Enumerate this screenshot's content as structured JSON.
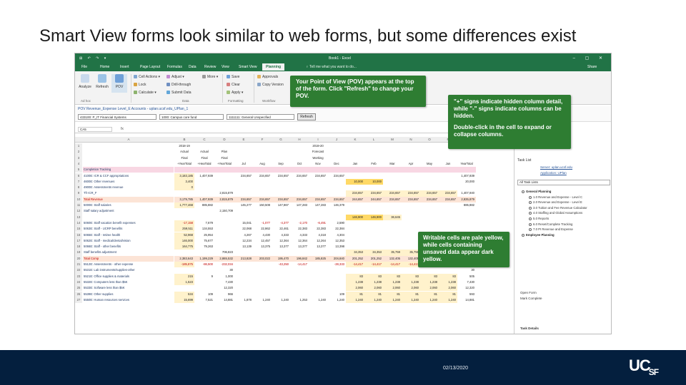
{
  "slide": {
    "title": "Smart View forms look similar to web forms, but some differences exist",
    "date": "02/13/2020",
    "logo_main": "UC",
    "logo_sub": "SF"
  },
  "colors": {
    "excel_green": "#217346",
    "callout_green": "#2e7d32",
    "footer_navy": "#041f3e",
    "writable_yellow": "#fff2cc",
    "unsaved_yellow": "#ffd966",
    "header_pink": "#f8d7e3"
  },
  "excel": {
    "quick_access": "⊞ ↶ ↷ ▾",
    "document_title": "Book1 - Excel",
    "window_controls": "– ▢ ✕",
    "tabs": [
      "File",
      "Home",
      "Insert",
      "Page Layout",
      "Formulas",
      "Data",
      "Review",
      "View",
      "Smart View",
      "Planning"
    ],
    "active_tab": "Planning",
    "tell_me": "♀ Tell me what you want to do...",
    "share": "Share",
    "ribbon": {
      "analyze": "Analyze",
      "refresh": "Refresh",
      "pov": "POV",
      "cell_actions": "Cell Actions ▾",
      "lock": "Lock",
      "calculate": "Calculate ▾",
      "adjust": "Adjust ▾",
      "drill_through": "Drill-through",
      "submit_data": "Submit Data",
      "more": "More ▾",
      "save": "Save",
      "clear": "Clear",
      "apply": "Apply ▾",
      "approvals": "Approvals",
      "copy_version": "Copy Version",
      "group_adhoc": "Ad hoc",
      "group_data": "Data",
      "group_formatting": "Formatting",
      "group_workflow": "Workflow"
    },
    "pov_bar": {
      "label": "POV Revenue_Expense Level_E Accounts - uplan.ucsf.edu_UPlan_1",
      "fields": [
        "433100: P_IT Financial Systems",
        "1000: Campus core fund",
        "1111111: General Unspecified"
      ],
      "refresh": "Refresh"
    },
    "name_box": "CA5",
    "fx": "fx"
  },
  "grid": {
    "col_headers": [
      "A",
      "B",
      "C",
      "D",
      "E",
      "F",
      "G",
      "H",
      "I",
      "J",
      "K",
      "L",
      "M",
      "N",
      "O",
      "P",
      "Q",
      "R"
    ],
    "header_rows": [
      {
        "n": "1",
        "cells": {
          "c1": "2018-19",
          "c8": "2019-20"
        }
      },
      {
        "n": "2",
        "cells": {
          "c1": "Actual",
          "c2": "Actual",
          "c3": "Plan",
          "c8": "Forecast"
        }
      },
      {
        "n": "3",
        "cells": {
          "c1": "Final",
          "c2": "Final",
          "c3": "Final",
          "c8": "Working"
        }
      },
      {
        "n": "4",
        "cells": {
          "c1": "+YearTotal",
          "c2": "+HeaTotal",
          "c3": "+YearTotal",
          "c4": "Jul",
          "c5": "Aug",
          "c6": "Sep",
          "c7": "Oct",
          "c8": "Nov",
          "c9": "Dec",
          "c10": "Jan",
          "c11": "Feb",
          "c12": "Mar",
          "c13": "Apr",
          "c14": "May",
          "c15": "Jun",
          "c16": "YearTotal"
        }
      }
    ],
    "data_rows": [
      {
        "n": "5",
        "label": "Completion Tracking",
        "vals": []
      },
      {
        "n": "6",
        "label": "4100E: ICR & CCF appropriations",
        "vals": [
          "3,183,185",
          "1,407,939",
          "",
          "234,657",
          "234,657",
          "234,657",
          "234,657",
          "234,657",
          "234,657",
          "",
          "",
          "",
          "",
          "",
          "",
          "1,407,939"
        ]
      },
      {
        "n": "7",
        "label": "4600E: Other revenues",
        "vals": [
          "3,400",
          "",
          "",
          "",
          "",
          "",
          "",
          "",
          "",
          "10,000",
          "10,000",
          "",
          "",
          "",
          "",
          "20,000"
        ]
      },
      {
        "n": "8",
        "label": "4900E: Assessments revenue",
        "vals": [
          "0",
          "",
          "",
          "",
          "",
          "",
          "",
          "",
          "",
          "",
          "",
          "",
          "",
          "",
          "",
          ""
        ]
      },
      {
        "n": "9",
        "label": "Tfr ICR_F",
        "vals": [
          "",
          "",
          "2,815,879",
          "",
          "",
          "",
          "",
          "",
          "",
          "234,657",
          "234,657",
          "234,657",
          "234,657",
          "234,657",
          "234,657",
          "1,407,940"
        ]
      },
      {
        "n": "10",
        "label": "Total Revenue",
        "vals": [
          "3,179,785",
          "1,407,939",
          "2,815,879",
          "234,657",
          "234,657",
          "234,657",
          "234,657",
          "234,657",
          "234,657",
          "244,657",
          "244,657",
          "234,657",
          "234,657",
          "234,657",
          "234,657",
          "2,835,879"
        ]
      },
      {
        "n": "11",
        "label": "5000E: Staff salaries",
        "vals": [
          "1,777,468",
          "885,882",
          "",
          "145,277",
          "150,508",
          "147,867",
          "147,283",
          "147,283",
          "146,379",
          "",
          "",
          "",
          "",
          "",
          "",
          "885,882"
        ]
      },
      {
        "n": "12",
        "label": "Staff salary adjustment",
        "vals": [
          "",
          "",
          "2,150,709",
          "",
          "",
          "",
          "",
          "",
          "",
          "",
          "",
          "",
          "",
          "",
          "",
          ""
        ]
      },
      {
        "n": "13",
        "label": "",
        "vals": [
          "",
          "",
          "",
          "",
          "",
          "",
          "",
          "",
          "",
          "146,900",
          "146,900",
          "36,645",
          "",
          "",
          "",
          ""
        ]
      },
      {
        "n": "14",
        "label": "5060E: Staff vacation benefit expenses",
        "vals": [
          "-17,158",
          "7,679",
          "",
          "15,041",
          "-1,077",
          "-4,377",
          "-2,170",
          "-6,491",
          "2,590",
          "",
          "",
          "",
          "",
          "",
          "",
          ""
        ]
      },
      {
        "n": "15",
        "label": "5063E: Staff - UCRP benefits",
        "vals": [
          "259,511",
          "134,553",
          "",
          "22,068",
          "22,862",
          "22,461",
          "22,383",
          "22,383",
          "22,384",
          "",
          "",
          "",
          "",
          "",
          "",
          ""
        ]
      },
      {
        "n": "16",
        "label": "5065E: Staff - retiree health",
        "vals": [
          "52,968",
          "25,954",
          "",
          "4,267",
          "4,430",
          "4,333",
          "4,333",
          "4,318",
          "4,304",
          "",
          "",
          "",
          "",
          "",
          "",
          ""
        ]
      },
      {
        "n": "17",
        "label": "5062E: Staff - medical/dental/vision",
        "vals": [
          "146,000",
          "75,677",
          "",
          "12,234",
          "12,457",
          "12,364",
          "12,364",
          "12,264",
          "12,353",
          "",
          "",
          "",
          "",
          "",
          "",
          ""
        ]
      },
      {
        "n": "18",
        "label": "5066E: Staff - other benefits",
        "vals": [
          "164,775",
          "79,263",
          "",
          "13,139",
          "13,375",
          "13,377",
          "13,377",
          "13,377",
          "13,398",
          "",
          "",
          "",
          "",
          "",
          "",
          ""
        ]
      },
      {
        "n": "19",
        "label": "Staff benefits adjustment",
        "vals": [
          "",
          "",
          "706,823",
          "",
          "",
          "",
          "",
          "",
          "",
          "34,353",
          "34,353",
          "35,759",
          "35,759",
          "35,759",
          "35,759",
          "251,741"
        ]
      },
      {
        "n": "20",
        "label": "Total Comp",
        "vals": [
          "2,383,643",
          "1,199,229",
          "2,865,532",
          "213,828",
          "203,022",
          "195,470",
          "196,842",
          "185,825",
          "204,840",
          "201,252",
          "201,252",
          "132,405",
          "132,405",
          "132,405",
          "132,405",
          "2,313,792"
        ]
      },
      {
        "n": "21",
        "label": "5512E: Assessments - other expense",
        "vals": [
          "-185,875",
          "-86,500",
          "-232,034",
          "",
          "",
          "-43,250",
          "-14,417",
          "",
          "-28,333",
          "-14,417",
          "-14,417",
          "-14,417",
          "-14,417",
          "-14,417",
          "-14,417",
          "-173,000"
        ]
      },
      {
        "n": "22",
        "label": "5531E: Lab instruments/supplies-other",
        "vals": [
          "",
          "",
          "30",
          "",
          "",
          "",
          "",
          "",
          "",
          "",
          "",
          "",
          "",
          "",
          "",
          "30"
        ]
      },
      {
        "n": "23",
        "label": "5521E: Office supplies & materials",
        "vals": [
          "215",
          "9",
          "1,000",
          "",
          "",
          "",
          "",
          "",
          "",
          "83",
          "83",
          "83",
          "83",
          "83",
          "83",
          "505"
        ]
      },
      {
        "n": "24",
        "label": "5532E: Computers less than $5K",
        "vals": [
          "1,523",
          "",
          "7,430",
          "",
          "",
          "",
          "",
          "",
          "",
          "1,238",
          "1,238",
          "1,238",
          "1,238",
          "1,238",
          "1,238",
          "7,430"
        ]
      },
      {
        "n": "25",
        "label": "5533E: Software less than $5K",
        "vals": [
          "",
          "",
          "12,320",
          "",
          "",
          "",
          "",
          "",
          "",
          "2,060",
          "2,060",
          "2,060",
          "2,060",
          "2,060",
          "2,060",
          "12,320"
        ]
      },
      {
        "n": "26",
        "label": "5539E: Other supplies",
        "vals": [
          "534",
          "109",
          "966",
          "",
          "",
          "",
          "",
          "",
          "109",
          "81",
          "81",
          "81",
          "81",
          "81",
          "81",
          "593"
        ]
      },
      {
        "n": "27",
        "label": "5550E: Human resources services",
        "vals": [
          "15,699",
          "7,521",
          "14,881",
          "1,878",
          "1,240",
          "1,240",
          "1,253",
          "1,240",
          "1,240",
          "1,240",
          "1,240",
          "1,240",
          "1,240",
          "1,240",
          "1,240",
          "14,881"
        ]
      }
    ]
  },
  "task_pane": {
    "title": "Task List",
    "links": [
      "Server: uplan.ucsf.edu",
      "Application: UPlan"
    ],
    "select": "All Task Lists",
    "tasks": [
      {
        "text": "General Planning",
        "bold": true
      },
      {
        "text": "1.0 Revenue and Expense - Level C",
        "bold": false
      },
      {
        "text": "2.0 Revenue and Expense - Level E",
        "bold": false
      },
      {
        "text": "3.0 Tuition and Fee Revenue Calculator",
        "bold": false
      },
      {
        "text": "4.0 Staffing and Global Assumptions",
        "bold": false
      },
      {
        "text": "5.0 Reports",
        "bold": false
      },
      {
        "text": "6.0 Reset/Complete Tracking",
        "bold": false
      },
      {
        "text": "7.0 PI Revenue and Expense",
        "bold": false
      },
      {
        "text": "Employee Planning",
        "bold": true
      }
    ],
    "footer": [
      "Open Form",
      "Mark Complete",
      "Task Details"
    ]
  },
  "callouts": {
    "pov": "Your Point of View (POV) appears at the top of the form. Click \"Refresh\" to change your POV.",
    "hidden_1": "\"+\" signs indicate hidden column detail, while \"-\" signs indicate columns can be hidden.",
    "hidden_2": "Double-click in the cell to expand or collapse columns.",
    "writable": "Writable cells are pale yellow, while cells containing unsaved data appear dark yellow."
  }
}
